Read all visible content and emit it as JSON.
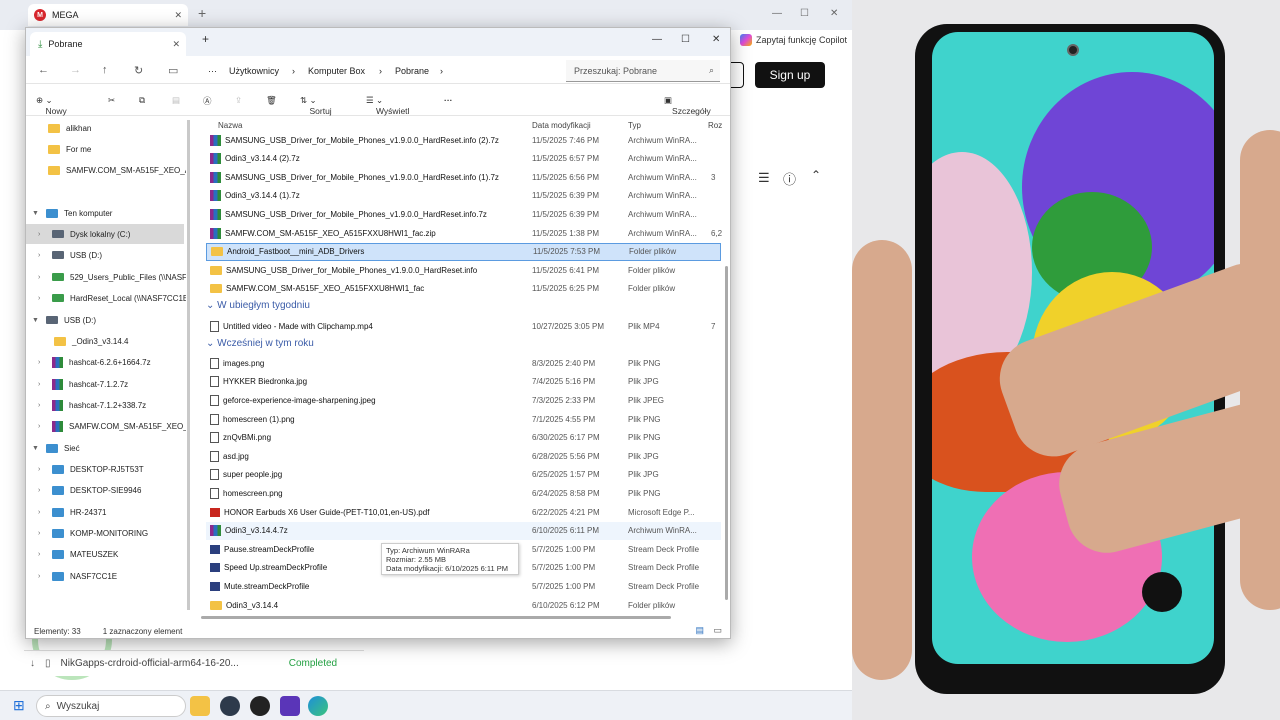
{
  "browser": {
    "tab_title": "MEGA",
    "copilot_label": "Zapytaj funkcję Copilot",
    "signup_label": "Sign up",
    "download": {
      "file": "NikGapps-crdroid-official-arm64-16-20...",
      "status": "Completed"
    }
  },
  "taskbar": {
    "search_placeholder": "Wyszukaj"
  },
  "explorer": {
    "tab_title": "Pobrane",
    "breadcrumb": [
      "Użytkownicy",
      "Komputer Box",
      "Pobrane"
    ],
    "search_placeholder": "Przeszukaj: Pobrane",
    "commands": {
      "new": "Nowy",
      "sort": "Sortuj",
      "view": "Wyświetl",
      "details": "Szczegóły"
    },
    "columns": {
      "name": "Nazwa",
      "date": "Data modyfikacji",
      "type": "Typ",
      "size": "Roz"
    },
    "sidebar": [
      {
        "label": "alikhan",
        "icon": "folder"
      },
      {
        "label": "For me",
        "icon": "folder"
      },
      {
        "label": "SAMFW.COM_SM-A515F_XEO_A51",
        "icon": "folder"
      },
      {
        "label": "Ten komputer",
        "icon": "computer"
      },
      {
        "label": "Dysk lokalny (C:)",
        "icon": "drive"
      },
      {
        "label": "USB (D:)",
        "icon": "drive"
      },
      {
        "label": "529_Users_Public_Files (\\\\NASF7C",
        "icon": "netdrive"
      },
      {
        "label": "HardReset_Local (\\\\NASF7CC1E)",
        "icon": "netdrive"
      },
      {
        "label": "USB (D:)",
        "icon": "drive"
      },
      {
        "label": "_Odin3_v3.14.4",
        "icon": "folder"
      },
      {
        "label": "hashcat-6.2.6+1664.7z",
        "icon": "archive"
      },
      {
        "label": "hashcat-7.1.2.7z",
        "icon": "archive"
      },
      {
        "label": "hashcat-7.1.2+338.7z",
        "icon": "archive"
      },
      {
        "label": "SAMFW.COM_SM-A515F_XEO_A5",
        "icon": "archive"
      },
      {
        "label": "Sieć",
        "icon": "network"
      },
      {
        "label": "DESKTOP-RJ5T53T",
        "icon": "pc"
      },
      {
        "label": "DESKTOP-SIE9946",
        "icon": "pc"
      },
      {
        "label": "HR-24371",
        "icon": "pc"
      },
      {
        "label": "KOMP-MONITORING",
        "icon": "pc"
      },
      {
        "label": "MATEUSZEK",
        "icon": "pc"
      },
      {
        "label": "NASF7CC1E",
        "icon": "pc"
      }
    ],
    "groups": {
      "last_week": "W ubiegłym tygodniu",
      "this_year": "Wcześniej w tym roku"
    },
    "files_top": [
      {
        "name": "SAMSUNG_USB_Driver_for_Mobile_Phones_v1.9.0.0_HardReset.info (2).7z",
        "date": "11/5/2025 7:46 PM",
        "type": "Archiwum WinRA...",
        "size": "",
        "icon": "archive"
      },
      {
        "name": "Odin3_v3.14.4 (2).7z",
        "date": "11/5/2025 6:57 PM",
        "type": "Archiwum WinRA...",
        "size": "",
        "icon": "archive"
      },
      {
        "name": "SAMSUNG_USB_Driver_for_Mobile_Phones_v1.9.0.0_HardReset.info (1).7z",
        "date": "11/5/2025 6:56 PM",
        "type": "Archiwum WinRA...",
        "size": "3",
        "icon": "archive"
      },
      {
        "name": "Odin3_v3.14.4 (1).7z",
        "date": "11/5/2025 6:39 PM",
        "type": "Archiwum WinRA...",
        "size": "",
        "icon": "archive"
      },
      {
        "name": "SAMSUNG_USB_Driver_for_Mobile_Phones_v1.9.0.0_HardReset.info.7z",
        "date": "11/5/2025 6:39 PM",
        "type": "Archiwum WinRA...",
        "size": "",
        "icon": "archive"
      },
      {
        "name": "SAMFW.COM_SM-A515F_XEO_A515FXXU8HWI1_fac.zip",
        "date": "11/5/2025 1:38 PM",
        "type": "Archiwum WinRA...",
        "size": "6,2",
        "icon": "archive"
      },
      {
        "name": "Android_Fastboot__mini_ADB_Drivers",
        "date": "11/5/2025 7:53 PM",
        "type": "Folder plików",
        "size": "",
        "icon": "folder",
        "selected": true
      },
      {
        "name": "SAMSUNG_USB_Driver_for_Mobile_Phones_v1.9.0.0_HardReset.info",
        "date": "11/5/2025 6:41 PM",
        "type": "Folder plików",
        "size": "",
        "icon": "folder"
      },
      {
        "name": "SAMFW.COM_SM-A515F_XEO_A515FXXU8HWI1_fac",
        "date": "11/5/2025 6:25 PM",
        "type": "Folder plików",
        "size": "",
        "icon": "folder"
      }
    ],
    "files_week": [
      {
        "name": "Untitled video - Made with Clipchamp.mp4",
        "date": "10/27/2025 3:05 PM",
        "type": "Plik MP4",
        "size": "7",
        "icon": "file"
      }
    ],
    "files_year": [
      {
        "name": "images.png",
        "date": "8/3/2025 2:40 PM",
        "type": "Plik PNG",
        "size": "",
        "icon": "file"
      },
      {
        "name": "HYKKER Biedronka.jpg",
        "date": "7/4/2025 5:16 PM",
        "type": "Plik JPG",
        "size": "",
        "icon": "file"
      },
      {
        "name": "geforce-experience-image-sharpening.jpeg",
        "date": "7/3/2025 2:33 PM",
        "type": "Plik JPEG",
        "size": "",
        "icon": "file"
      },
      {
        "name": "homescreen (1).png",
        "date": "7/1/2025 4:55 PM",
        "type": "Plik PNG",
        "size": "",
        "icon": "file"
      },
      {
        "name": "znQvBMi.png",
        "date": "6/30/2025 6:17 PM",
        "type": "Plik PNG",
        "size": "",
        "icon": "file"
      },
      {
        "name": "asd.jpg",
        "date": "6/28/2025 5:56 PM",
        "type": "Plik JPG",
        "size": "",
        "icon": "file"
      },
      {
        "name": "super people.jpg",
        "date": "6/25/2025 1:57 PM",
        "type": "Plik JPG",
        "size": "",
        "icon": "file"
      },
      {
        "name": "homescreen.png",
        "date": "6/24/2025 8:58 PM",
        "type": "Plik PNG",
        "size": "",
        "icon": "file"
      },
      {
        "name": "HONOR Earbuds X6 User Guide-(PET-T10,01,en-US).pdf",
        "date": "6/22/2025 4:21 PM",
        "type": "Microsoft Edge P...",
        "size": "",
        "icon": "pdf"
      },
      {
        "name": "Odin3_v3.14.4.7z",
        "date": "6/10/2025 6:11 PM",
        "type": "Archiwum WinRA...",
        "size": "",
        "icon": "archive",
        "hover": true
      },
      {
        "name": "Pause.streamDeckProfile",
        "date": "5/7/2025 1:00 PM",
        "type": "Stream Deck Profile",
        "size": "",
        "icon": "profile"
      },
      {
        "name": "Speed Up.streamDeckProfile",
        "date": "5/7/2025 1:00 PM",
        "type": "Stream Deck Profile",
        "size": "",
        "icon": "profile"
      },
      {
        "name": "Mute.streamDeckProfile",
        "date": "5/7/2025 1:00 PM",
        "type": "Stream Deck Profile",
        "size": "",
        "icon": "profile"
      },
      {
        "name": "Odin3_v3.14.4",
        "date": "6/10/2025 6:12 PM",
        "type": "Folder plików",
        "size": "",
        "icon": "folder"
      }
    ],
    "tooltip": [
      "Typ: Archiwum WinRARa",
      "Rozmiar: 2.55 MB",
      "Data modyfikacji: 6/10/2025 6:11 PM"
    ],
    "status": {
      "count": "Elementy: 33",
      "selected": "1 zaznaczony element"
    }
  }
}
